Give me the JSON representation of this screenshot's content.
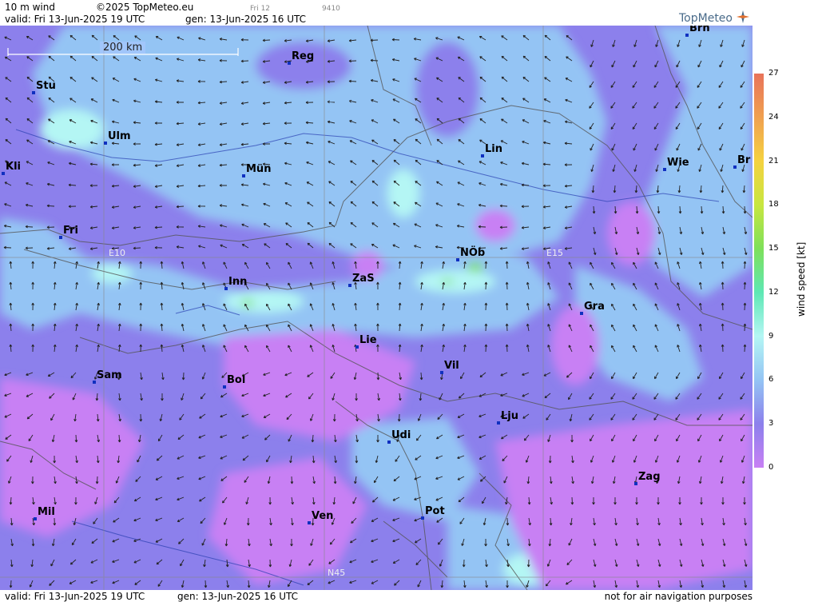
{
  "header": {
    "product": "10 m wind",
    "copyright": "©2025 TopMeteo.eu",
    "tab_small": "Fri 12",
    "code_small": "9410",
    "valid": "valid:  Fri  13-Jun-2025  19 UTC",
    "gen": "gen: 13-Jun-2025 16 UTC"
  },
  "brand": {
    "name": "TopMeteo"
  },
  "scale_bar": {
    "label": "200 km"
  },
  "grid_labels": {
    "e10": "E10",
    "e15": "E15",
    "n45": "N45"
  },
  "cities": [
    {
      "name": "Stu"
    },
    {
      "name": "Reg"
    },
    {
      "name": "Brn"
    },
    {
      "name": "Ulm"
    },
    {
      "name": "Kli"
    },
    {
      "name": "Mün"
    },
    {
      "name": "Lin"
    },
    {
      "name": "Wie"
    },
    {
      "name": "Br"
    },
    {
      "name": "Fri"
    },
    {
      "name": "NÖb"
    },
    {
      "name": "Inn"
    },
    {
      "name": "ZaS"
    },
    {
      "name": "Gra"
    },
    {
      "name": "Lie"
    },
    {
      "name": "Vil"
    },
    {
      "name": "Sam"
    },
    {
      "name": "Bol"
    },
    {
      "name": "Lju"
    },
    {
      "name": "Udi"
    },
    {
      "name": "Zag"
    },
    {
      "name": "Mil"
    },
    {
      "name": "Ven"
    },
    {
      "name": "Pot"
    }
  ],
  "legend": {
    "title": "wind speed  [kt]",
    "ticks": [
      "27",
      "24",
      "21",
      "18",
      "15",
      "12",
      "9",
      "6",
      "3",
      "0"
    ],
    "colors": [
      "#e8735a",
      "#f0a050",
      "#f5d240",
      "#c8e640",
      "#7ee05a",
      "#5ee8b4",
      "#b4f6f4",
      "#94c4f4",
      "#8c80ec",
      "#c880f4"
    ]
  },
  "footer": {
    "valid": "valid:  Fri  13-Jun-2025  19 UTC",
    "gen": "gen: 13-Jun-2025 16 UTC",
    "note": "not for air navigation purposes"
  }
}
